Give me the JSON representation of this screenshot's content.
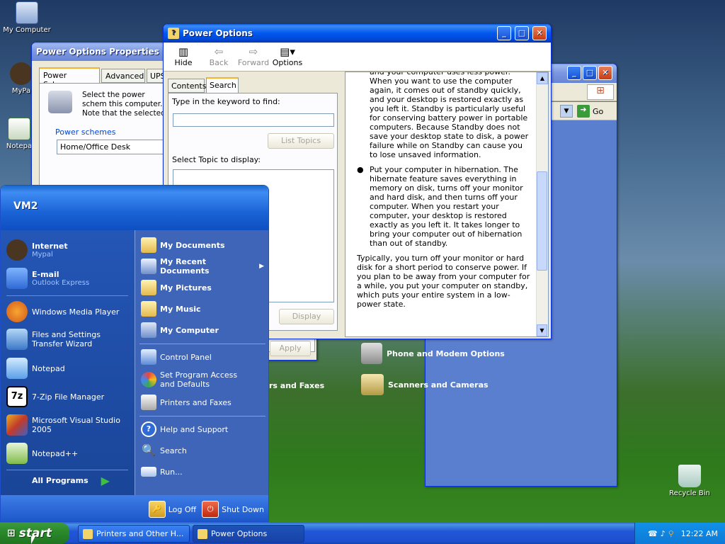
{
  "desktop": {
    "icons": [
      {
        "label": "My Computer"
      },
      {
        "label": "MyPa"
      },
      {
        "label": "Notepa"
      },
      {
        "label": "Recycle Bin"
      }
    ]
  },
  "control_panel": {
    "go_label": "Go",
    "items": [
      {
        "label": "Phone and Modem Options"
      },
      {
        "label": "Scanners and Cameras"
      },
      {
        "label": "rs and Faxes"
      }
    ]
  },
  "power_props": {
    "title": "Power Options Properties",
    "tabs": [
      "Power Schemes",
      "Advanced",
      "UPS"
    ],
    "desc": "Select the power schem this computer. Note that the selected scheme.",
    "schemes_label": "Power schemes",
    "scheme_value": "Home/Office Desk",
    "apply_label": "Apply"
  },
  "help": {
    "title": "Power Options",
    "toolbar": [
      {
        "label": "Hide"
      },
      {
        "label": "Back"
      },
      {
        "label": "Forward"
      },
      {
        "label": "Options"
      }
    ],
    "tabs": [
      "Contents",
      "Search"
    ],
    "keyword_label": "Type in the keyword to find:",
    "list_topics": "List Topics",
    "select_topic": "Select Topic to display:",
    "display": "Display",
    "para1": "and your computer uses less power. When you want to use the computer again, it comes out of standby quickly, and your desktop is restored exactly as you left it. Standby is particularly useful for conserving battery power in portable computers. Because Standby does not save your desktop state to disk, a power failure while on Standby can cause you to lose unsaved information.",
    "para2": "Put your computer in hibernation. The hibernate feature saves everything in memory on disk, turns off your monitor and hard disk, and then turns off your computer. When you restart your computer, your desktop is restored exactly as you left it. It takes longer to bring your computer out of hibernation than out of standby.",
    "para3": "Typically, you turn off your monitor or hard disk for a short period to conserve power. If you plan to be away from your computer for a while, you put your computer on standby, which puts your entire system in a low-power state."
  },
  "start_menu": {
    "user": "VM2",
    "left": [
      {
        "label": "Internet",
        "sub": "Mypal"
      },
      {
        "label": "E-mail",
        "sub": "Outlook Express"
      },
      {
        "label": "Windows Media Player"
      },
      {
        "label": "Files and Settings Transfer Wizard"
      },
      {
        "label": "Notepad"
      },
      {
        "label": "7-Zip File Manager"
      },
      {
        "label": "Microsoft Visual Studio 2005"
      },
      {
        "label": "Notepad++"
      }
    ],
    "all_programs": "All Programs",
    "right": [
      {
        "label": "My Documents"
      },
      {
        "label": "My Recent Documents"
      },
      {
        "label": "My Pictures"
      },
      {
        "label": "My Music"
      },
      {
        "label": "My Computer"
      },
      {
        "label": "Control Panel"
      },
      {
        "label": "Set Program Access and Defaults"
      },
      {
        "label": "Printers and Faxes"
      },
      {
        "label": "Help and Support"
      },
      {
        "label": "Search"
      },
      {
        "label": "Run..."
      }
    ],
    "log_off": "Log Off",
    "shut_down": "Shut Down"
  },
  "taskbar": {
    "start": "start",
    "tasks": [
      {
        "label": "Printers and Other H..."
      },
      {
        "label": "Power Options"
      }
    ],
    "clock": "12:22 AM"
  }
}
